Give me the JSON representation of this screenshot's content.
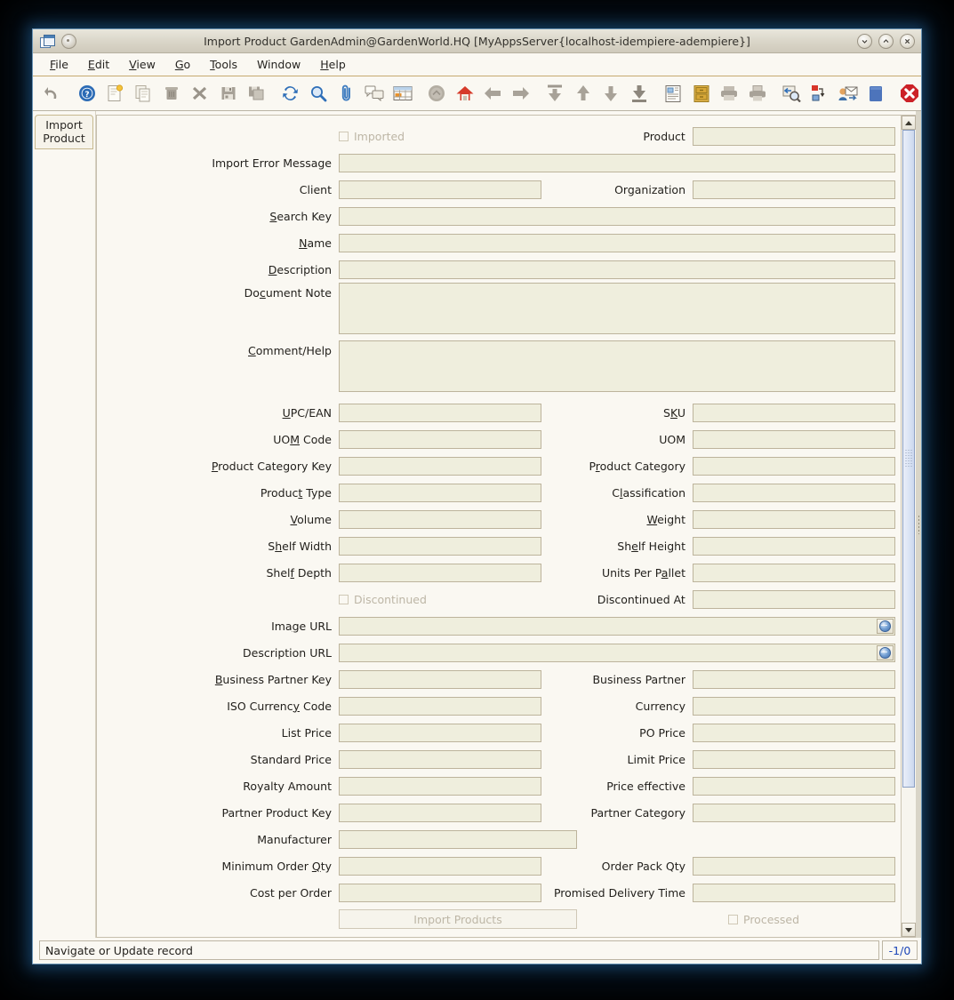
{
  "window": {
    "title": "Import Product  GardenAdmin@GardenWorld.HQ [MyAppsServer{localhost-idempiere-adempiere}]",
    "minimize_glyph": "⌄",
    "maximize_glyph": "⌃",
    "close_glyph": "✕"
  },
  "menubar": [
    {
      "label": "File",
      "mnemonic": "F"
    },
    {
      "label": "Edit",
      "mnemonic": "E"
    },
    {
      "label": "View",
      "mnemonic": "V"
    },
    {
      "label": "Go",
      "mnemonic": "G"
    },
    {
      "label": "Tools",
      "mnemonic": "T"
    },
    {
      "label": "Window",
      "mnemonic": ""
    },
    {
      "label": "Help",
      "mnemonic": "H"
    }
  ],
  "toolbar": [
    {
      "name": "undo-icon",
      "title": "Undo"
    },
    {
      "name": "help-icon",
      "title": "Help"
    },
    {
      "name": "new-record-icon",
      "title": "New Record"
    },
    {
      "name": "copy-record-icon",
      "title": "Copy Record"
    },
    {
      "name": "delete-record-icon",
      "title": "Delete Record"
    },
    {
      "name": "delete-selection-icon",
      "title": "Delete Selection"
    },
    {
      "name": "save-icon",
      "title": "Save Changes"
    },
    {
      "name": "save-create-icon",
      "title": "Save and Create New"
    },
    {
      "name": "refresh-icon",
      "title": "Refresh"
    },
    {
      "name": "find-icon",
      "title": "Find"
    },
    {
      "name": "attachment-icon",
      "title": "Attachment"
    },
    {
      "name": "chat-icon",
      "title": "Chat"
    },
    {
      "name": "grid-toggle-icon",
      "title": "Toggle Grid View"
    },
    {
      "name": "history-icon",
      "title": "History Records"
    },
    {
      "name": "home-icon",
      "title": "Home"
    },
    {
      "name": "back-icon",
      "title": "Previous Record"
    },
    {
      "name": "forward-icon",
      "title": "Next Record"
    },
    {
      "name": "first-record-icon",
      "title": "First Record"
    },
    {
      "name": "up-icon",
      "title": "Parent Record"
    },
    {
      "name": "down-icon",
      "title": "Detail Record"
    },
    {
      "name": "last-record-icon",
      "title": "Last Record"
    },
    {
      "name": "report-icon",
      "title": "Report"
    },
    {
      "name": "archive-icon",
      "title": "Archived Documents"
    },
    {
      "name": "print-preview-icon",
      "title": "Print Preview"
    },
    {
      "name": "print-icon",
      "title": "Print"
    },
    {
      "name": "zoom-across-icon",
      "title": "Zoom Across"
    },
    {
      "name": "active-workflow-icon",
      "title": "Active Workflow"
    },
    {
      "name": "request-icon",
      "title": "Requests"
    },
    {
      "name": "product-info-icon",
      "title": "Product Info"
    },
    {
      "name": "exit-icon",
      "title": "Exit"
    }
  ],
  "tabs": [
    {
      "label": "Import\nProduct",
      "line1": "Import",
      "line2": "Product",
      "selected": true
    }
  ],
  "form": {
    "imported_checkbox": {
      "label": "Imported",
      "checked": false,
      "enabled": false
    },
    "product_label": "Product",
    "rows": [
      {
        "label": "Import Error Message",
        "mnemonic": "",
        "type": "text-full"
      },
      {
        "label": "Client",
        "mnemonic": "",
        "right_label": "Organization",
        "type": "pair"
      },
      {
        "label": "Search Key",
        "mnemonic": "S",
        "type": "text-full"
      },
      {
        "label": "Name",
        "mnemonic": "N",
        "type": "text-full"
      },
      {
        "label": "Description",
        "mnemonic": "D",
        "type": "text-full"
      },
      {
        "label": "Document Note",
        "mnemonic": "c",
        "type": "textarea"
      },
      {
        "label": "Comment/Help",
        "mnemonic": "C",
        "type": "textarea"
      },
      {
        "label": "UPC/EAN",
        "mnemonic": "U",
        "right_label": "SKU",
        "right_mnemonic": "K",
        "type": "pair"
      },
      {
        "label": "UOM Code",
        "mnemonic": "M",
        "right_label": "UOM",
        "type": "pair"
      },
      {
        "label": "Product Category Key",
        "mnemonic": "P",
        "right_label": "Product Category",
        "right_mnemonic": "r",
        "type": "pair"
      },
      {
        "label": "Product Type",
        "mnemonic": "t",
        "right_label": "Classification",
        "right_mnemonic": "l",
        "type": "pair"
      },
      {
        "label": "Volume",
        "mnemonic": "V",
        "right_label": "Weight",
        "right_mnemonic": "W",
        "type": "pair"
      },
      {
        "label": "Shelf Width",
        "mnemonic": "h",
        "right_label": "Shelf Height",
        "right_mnemonic": "e",
        "type": "pair"
      },
      {
        "label": "Shelf Depth",
        "mnemonic": "f",
        "right_label": "Units Per Pallet",
        "right_mnemonic": "a",
        "type": "pair"
      },
      {
        "label": "Discontinued",
        "type": "checkbox-pair",
        "right_label": "Discontinued At"
      },
      {
        "label": "Image URL",
        "mnemonic": "g",
        "type": "url"
      },
      {
        "label": "Description URL",
        "mnemonic": "",
        "type": "url"
      },
      {
        "label": "Business Partner Key",
        "mnemonic": "B",
        "right_label": "Business Partner",
        "type": "pair"
      },
      {
        "label": "ISO Currency Code",
        "mnemonic": "y",
        "right_label": "Currency",
        "type": "pair"
      },
      {
        "label": "List Price",
        "mnemonic": "",
        "right_label": "PO Price",
        "type": "pair"
      },
      {
        "label": "Standard Price",
        "mnemonic": "",
        "right_label": "Limit Price",
        "type": "pair"
      },
      {
        "label": "Royalty Amount",
        "mnemonic": "",
        "right_label": "Price effective",
        "type": "pair"
      },
      {
        "label": "Partner Product Key",
        "mnemonic": "",
        "right_label": "Partner Category",
        "type": "pair"
      },
      {
        "label": "Manufacturer",
        "mnemonic": "",
        "right_label": "",
        "type": "pair"
      },
      {
        "label": "Minimum Order Qty",
        "mnemonic": "Q",
        "right_label": "Order Pack Qty",
        "type": "pair"
      },
      {
        "label": "Cost per Order",
        "mnemonic": "",
        "right_label": "Promised Delivery Time",
        "type": "pair"
      }
    ],
    "import_button": {
      "label": "Import Products",
      "enabled": false
    },
    "processed_checkbox": {
      "label": "Processed",
      "checked": false,
      "enabled": false
    }
  },
  "statusbar": {
    "message": "Navigate or Update record",
    "record_count": "-1/0"
  },
  "colors": {
    "window_bg": "#faf8f2",
    "field_bg": "#efeedd",
    "field_border": "#bdb49c",
    "menu_underline": "#c6a96f",
    "status_count": "#1c46b8",
    "scroll_thumb": "#dfe7f6"
  }
}
